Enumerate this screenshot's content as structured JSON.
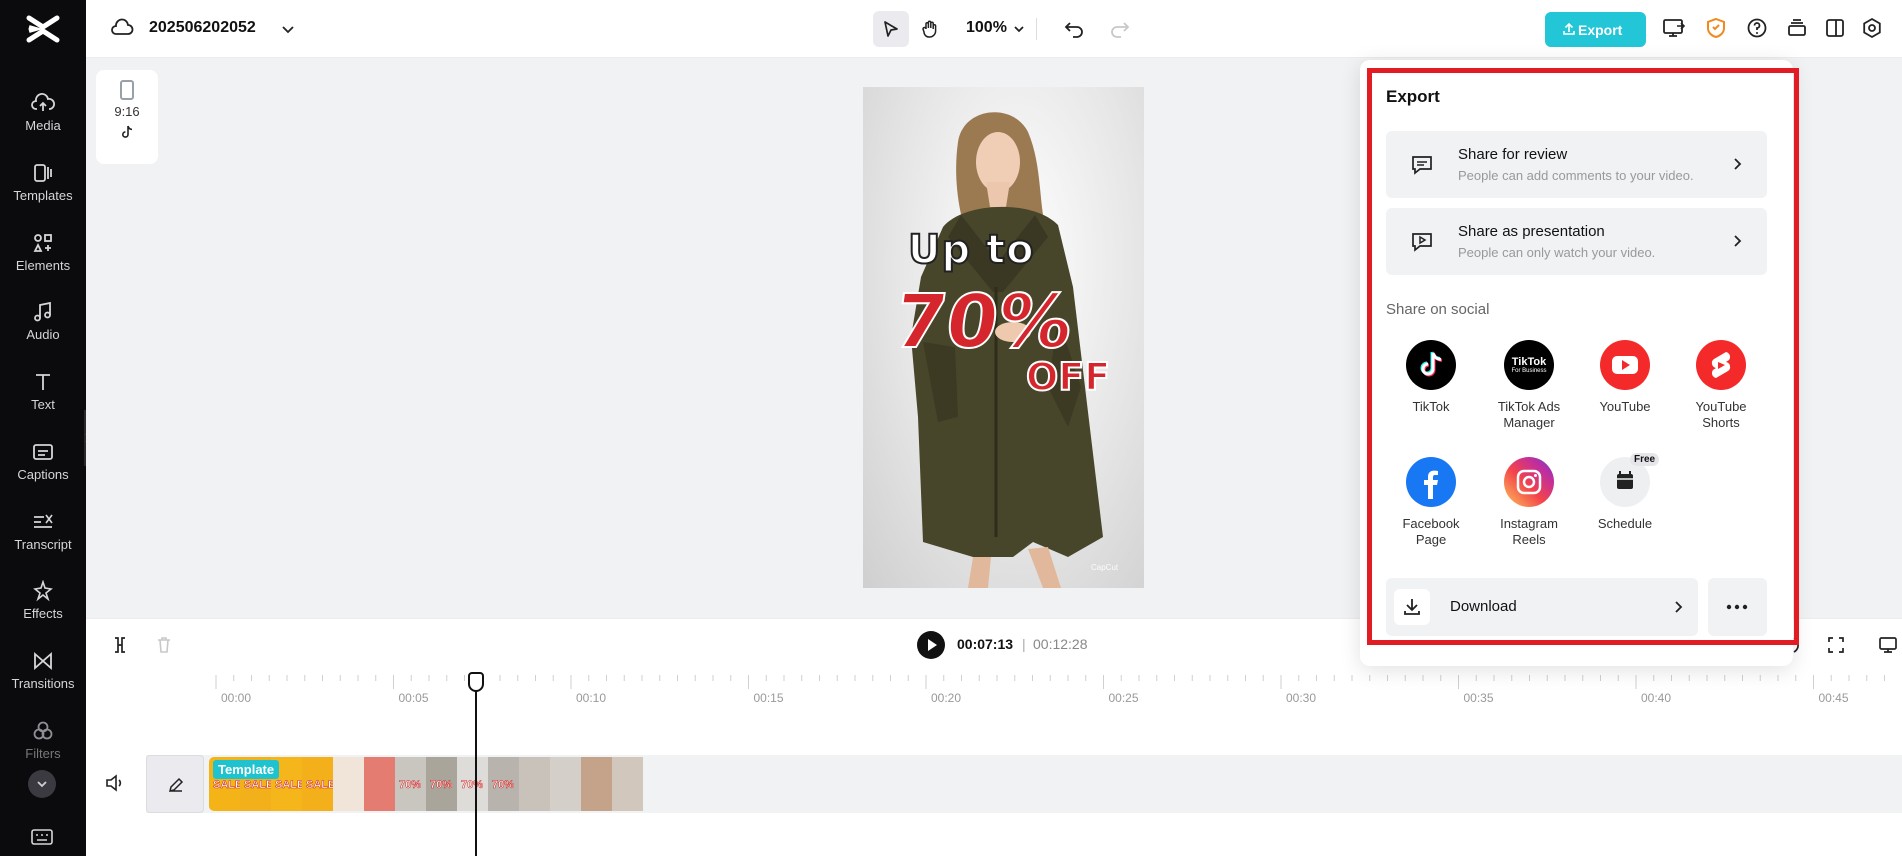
{
  "header": {
    "project_title": "202506202052",
    "zoom": "100%",
    "export_label": "Export"
  },
  "sidebar": {
    "items": [
      {
        "label": "Media",
        "icon": "cloud-upload-icon"
      },
      {
        "label": "Templates",
        "icon": "templates-icon"
      },
      {
        "label": "Elements",
        "icon": "elements-icon"
      },
      {
        "label": "Audio",
        "icon": "music-note-icon"
      },
      {
        "label": "Text",
        "icon": "text-icon"
      },
      {
        "label": "Captions",
        "icon": "captions-icon"
      },
      {
        "label": "Transcript",
        "icon": "transcript-icon"
      },
      {
        "label": "Effects",
        "icon": "effects-icon"
      },
      {
        "label": "Transitions",
        "icon": "transitions-icon"
      },
      {
        "label": "Filters",
        "icon": "filters-icon"
      }
    ]
  },
  "canvas": {
    "ratio": "9:16",
    "preview": {
      "line1": "Up to",
      "line2": "70%",
      "line3": "OFF",
      "watermark": "CapCut"
    }
  },
  "timeline": {
    "current_time": "00:07:13",
    "separator": "|",
    "total_time": "00:12:28",
    "ticks": [
      "00:00",
      "00:05",
      "00:10",
      "00:15",
      "00:20",
      "00:25",
      "00:30",
      "00:35",
      "00:40",
      "00:45"
    ],
    "template_badge": "Template",
    "thumbs": [
      {
        "text": "SALE",
        "color": "#f4b418"
      },
      {
        "text": "SALE",
        "color": "#f2b11a"
      },
      {
        "text": "SALE",
        "color": "#f5b61c"
      },
      {
        "text": "SALE",
        "color": "#f3b01b"
      },
      {
        "text": "",
        "color": "#f1e4d8"
      },
      {
        "text": "",
        "color": "#e57c72"
      },
      {
        "text": "70%",
        "color": "#c9c6bf"
      },
      {
        "text": "70%",
        "color": "#a9a59a"
      },
      {
        "text": "70%",
        "color": "#dedcd8"
      },
      {
        "text": "70%",
        "color": "#b8b4ad"
      },
      {
        "text": "",
        "color": "#c8c2ba"
      },
      {
        "text": "",
        "color": "#d4cfc8"
      },
      {
        "text": "",
        "color": "#c5a28a"
      },
      {
        "text": "",
        "color": "#d2c7bd"
      }
    ]
  },
  "export_panel": {
    "title": "Export",
    "share_review": {
      "title": "Share for review",
      "subtitle": "People can add comments to your video."
    },
    "share_presentation": {
      "title": "Share as presentation",
      "subtitle": "People can only watch your video."
    },
    "social_heading": "Share on social",
    "socials": [
      {
        "name": "TikTok",
        "icon": "tiktok-icon"
      },
      {
        "name": "TikTok Ads Manager",
        "icon": "tiktok-business-icon",
        "logo_text": "TikTok",
        "logo_sub": "For Business"
      },
      {
        "name": "YouTube",
        "icon": "youtube-icon"
      },
      {
        "name": "YouTube Shorts",
        "icon": "youtube-shorts-icon"
      },
      {
        "name": "Facebook Page",
        "icon": "facebook-icon"
      },
      {
        "name": "Instagram Reels",
        "icon": "instagram-icon"
      },
      {
        "name": "Schedule",
        "icon": "calendar-icon",
        "badge": "Free"
      }
    ],
    "download_label": "Download"
  },
  "colors": {
    "accent": "#22c6d6",
    "highlight": "#e21c23",
    "sidebar_bg": "#0b0b0d"
  }
}
